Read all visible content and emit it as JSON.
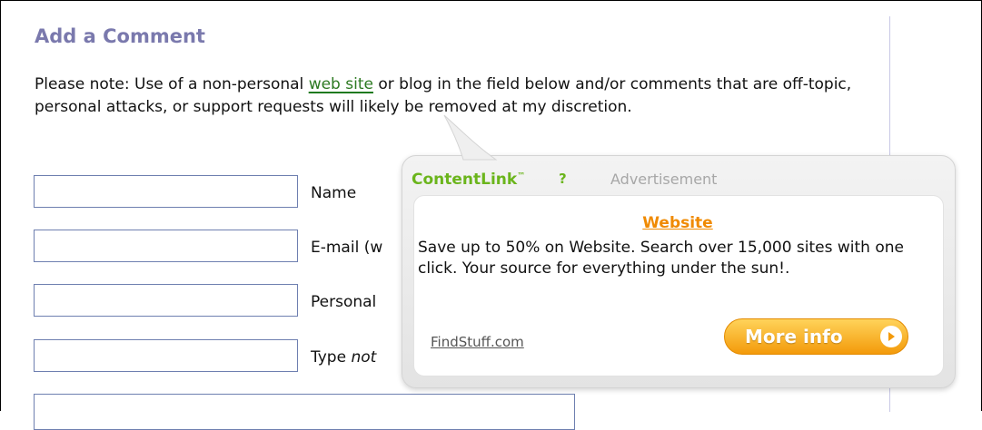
{
  "heading": "Add a Comment",
  "note": {
    "before": "Please note: Use of a non-personal ",
    "link": "web site",
    "after": " or blog in the field below and/or comments that are off-topic, personal attacks, or support requests will likely be removed at my discretion."
  },
  "fields": {
    "name_label": "Name",
    "email_label": "E-mail (w",
    "personal_label": "Personal",
    "type_label_prefix": "Type ",
    "type_label_em": "not"
  },
  "ad": {
    "brand": "ContentLink",
    "trademark": "™",
    "help": "?",
    "label": "Advertisement",
    "title": "Website",
    "body": "Save up to 50% on Website. Search over 15,000 sites with one click. Your source for everything under the sun!.",
    "source": "FindStuff.com",
    "button": "More info",
    "arrow_icon": "play-arrow-icon"
  },
  "colors": {
    "heading": "#7a79ad",
    "link": "#2d7a22",
    "brand": "#6bb51c",
    "ad_title": "#f08a00",
    "button": "#f39a0a"
  }
}
